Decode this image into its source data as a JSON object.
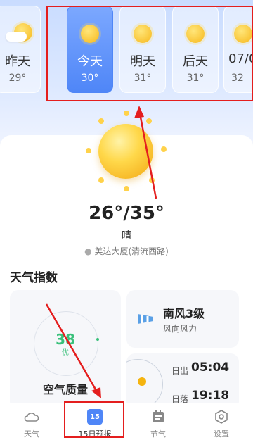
{
  "days": [
    {
      "name": "昨天",
      "temp": "29°",
      "icon": "sun-cloud-icon",
      "active": false
    },
    {
      "name": "今天",
      "temp": "30°",
      "icon": "sun-icon",
      "active": true
    },
    {
      "name": "明天",
      "temp": "31°",
      "icon": "sun-icon",
      "active": false
    },
    {
      "name": "后天",
      "temp": "31°",
      "icon": "sun-icon",
      "active": false
    },
    {
      "name": "07/0",
      "temp": "32",
      "icon": "sun-icon",
      "active": false
    }
  ],
  "current": {
    "temp_range": "26°/35°",
    "condition": "晴",
    "location": "美达大厦(清流西路)"
  },
  "section_title": "天气指数",
  "air_quality": {
    "value": "38",
    "level": "优",
    "title": "空气质量"
  },
  "wind": {
    "title": "南风3级",
    "subtitle": "风向风力"
  },
  "sun": {
    "rise_label": "日出",
    "rise_time": "05:04",
    "set_label": "日落",
    "set_time": "19:18"
  },
  "tabs": [
    {
      "label": "天气",
      "icon": "cloud-icon"
    },
    {
      "label": "15日预报",
      "icon": "calendar-icon",
      "badge": "15",
      "active": true
    },
    {
      "label": "节气",
      "icon": "calendar-note-icon"
    },
    {
      "label": "设置",
      "icon": "settings-icon"
    }
  ],
  "colors": {
    "highlight": "#e41e1e",
    "active_blue": "#4f86f7",
    "aq_green": "#39c07a"
  }
}
